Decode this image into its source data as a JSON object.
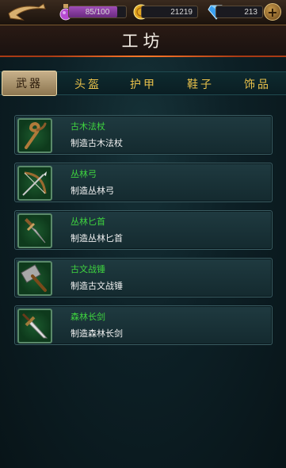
{
  "topbar": {
    "energy": {
      "text": "85/100",
      "fraction": 0.85
    },
    "gold": "21219",
    "gems": "213",
    "icons": {
      "back": "back-arrow-icon",
      "energy": "potion-icon",
      "gold": "gold-coin-icon",
      "gems": "diamond-icon",
      "plus": "plus-icon"
    },
    "plus_label": "+"
  },
  "title": "工坊",
  "tabs": [
    {
      "label": "武器",
      "active": true
    },
    {
      "label": "头盔",
      "active": false
    },
    {
      "label": "护甲",
      "active": false
    },
    {
      "label": "鞋子",
      "active": false
    },
    {
      "label": "饰品",
      "active": false
    }
  ],
  "items": [
    {
      "name": "古木法杖",
      "desc": "制造古木法杖",
      "icon": "staff-icon"
    },
    {
      "name": "丛林弓",
      "desc": "制造丛林弓",
      "icon": "bow-icon"
    },
    {
      "name": "丛林匕首",
      "desc": "制造丛林匕首",
      "icon": "dagger-icon"
    },
    {
      "name": "古文战锤",
      "desc": "制造古文战锤",
      "icon": "warhammer-icon"
    },
    {
      "name": "森林长剑",
      "desc": "制造森林长剑",
      "icon": "longsword-icon"
    }
  ],
  "colors": {
    "item_name": "#3fd43f",
    "tab_text": "#e8c04a",
    "accent": "#a83a14"
  }
}
